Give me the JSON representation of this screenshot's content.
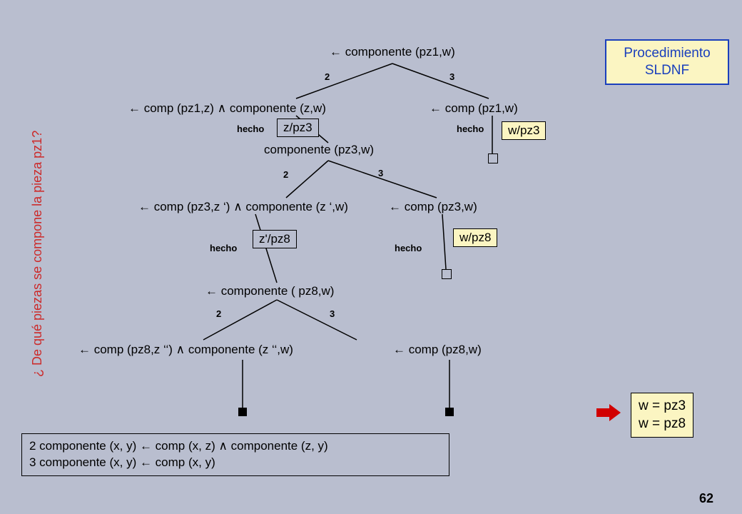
{
  "proc_title_line1": "Procedimiento",
  "proc_title_line2": "SLDNF",
  "side_question": "¿ De qué piezas se compone la pieza pz1?",
  "page_number": "62",
  "labels": {
    "hecho": "hecho",
    "two": "2",
    "three": "3"
  },
  "nodes": {
    "root": "← componente (pz1,w)",
    "n_left1": "← comp (pz1,z)  ∧ componente (z,w)",
    "n_right1": "← comp (pz1,w)",
    "sub_z_pz3": "z/pz3",
    "sub_w_pz3": "w/pz3",
    "n_mid1": "componente (pz3,w)",
    "n_left2": "← comp (pz3,z ‘)  ∧ componente (z ‘,w)",
    "n_right2": "← comp (pz3,w)",
    "sub_zp_pz8": "z'/pz8",
    "sub_w_pz8": "w/pz8",
    "n_mid2": "← componente ( pz8,w)",
    "n_left3": "← comp (pz8,z ‘‘)  ∧ componente (z ‘‘,w)",
    "n_right3": "← comp (pz8,w)"
  },
  "rules": {
    "r2": "2  componente (x, y) ← comp (x, z)  ∧ componente (z, y)",
    "r3": "3  componente (x, y) ← comp (x, y)"
  },
  "result": {
    "line1": "w = pz3",
    "line2": "w = pz8"
  }
}
